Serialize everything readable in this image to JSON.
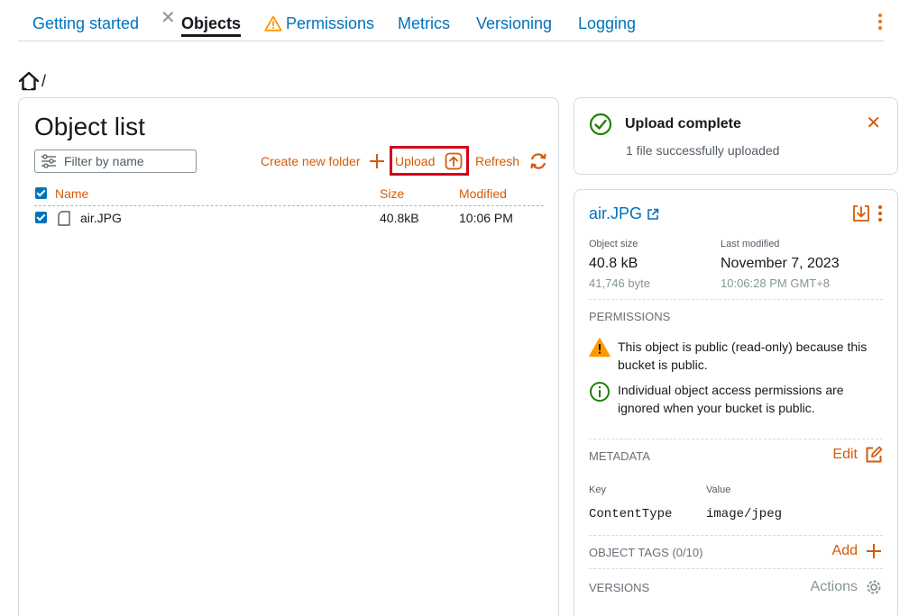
{
  "tabs": {
    "getting_started": "Getting started",
    "objects": "Objects",
    "permissions": "Permissions",
    "metrics": "Metrics",
    "versioning": "Versioning",
    "logging": "Logging"
  },
  "breadcrumb": {
    "separator": "/"
  },
  "object_list": {
    "title": "Object list",
    "filter_placeholder": "Filter by name",
    "create_folder_label": "Create new folder",
    "upload_label": "Upload",
    "refresh_label": "Refresh",
    "columns": {
      "name": "Name",
      "size": "Size",
      "modified": "Modified"
    },
    "rows": [
      {
        "name": "air.JPG",
        "size": "40.8kB",
        "modified": "10:06 PM",
        "checked": true
      }
    ]
  },
  "notification": {
    "title": "Upload complete",
    "message": "1 file successfully uploaded"
  },
  "details": {
    "file_name": "air.JPG",
    "object_size_label": "Object size",
    "object_size": "40.8 kB",
    "object_bytes": "41,746 byte",
    "last_modified_label": "Last modified",
    "last_modified_date": "November 7, 2023",
    "last_modified_time": "10:06:28 PM GMT+8",
    "permissions_label": "PERMISSIONS",
    "public_warning": "This object is public (read-only) because this bucket is public.",
    "permissions_info": "Individual object access permissions are ignored when your bucket is public.",
    "metadata_label": "METADATA",
    "edit_label": "Edit",
    "key_label": "Key",
    "value_label": "Value",
    "metadata_key": "ContentType",
    "metadata_value": "image/jpeg",
    "tags_label": "OBJECT TAGS (0/10)",
    "add_label": "Add",
    "versions_label": "VERSIONS",
    "actions_label": "Actions"
  },
  "colors": {
    "link_blue": "#0073bb",
    "accent_orange": "#d45b07",
    "highlight_red": "#d0021b",
    "success_green": "#1d8102",
    "warning_orange": "#ff9900"
  }
}
